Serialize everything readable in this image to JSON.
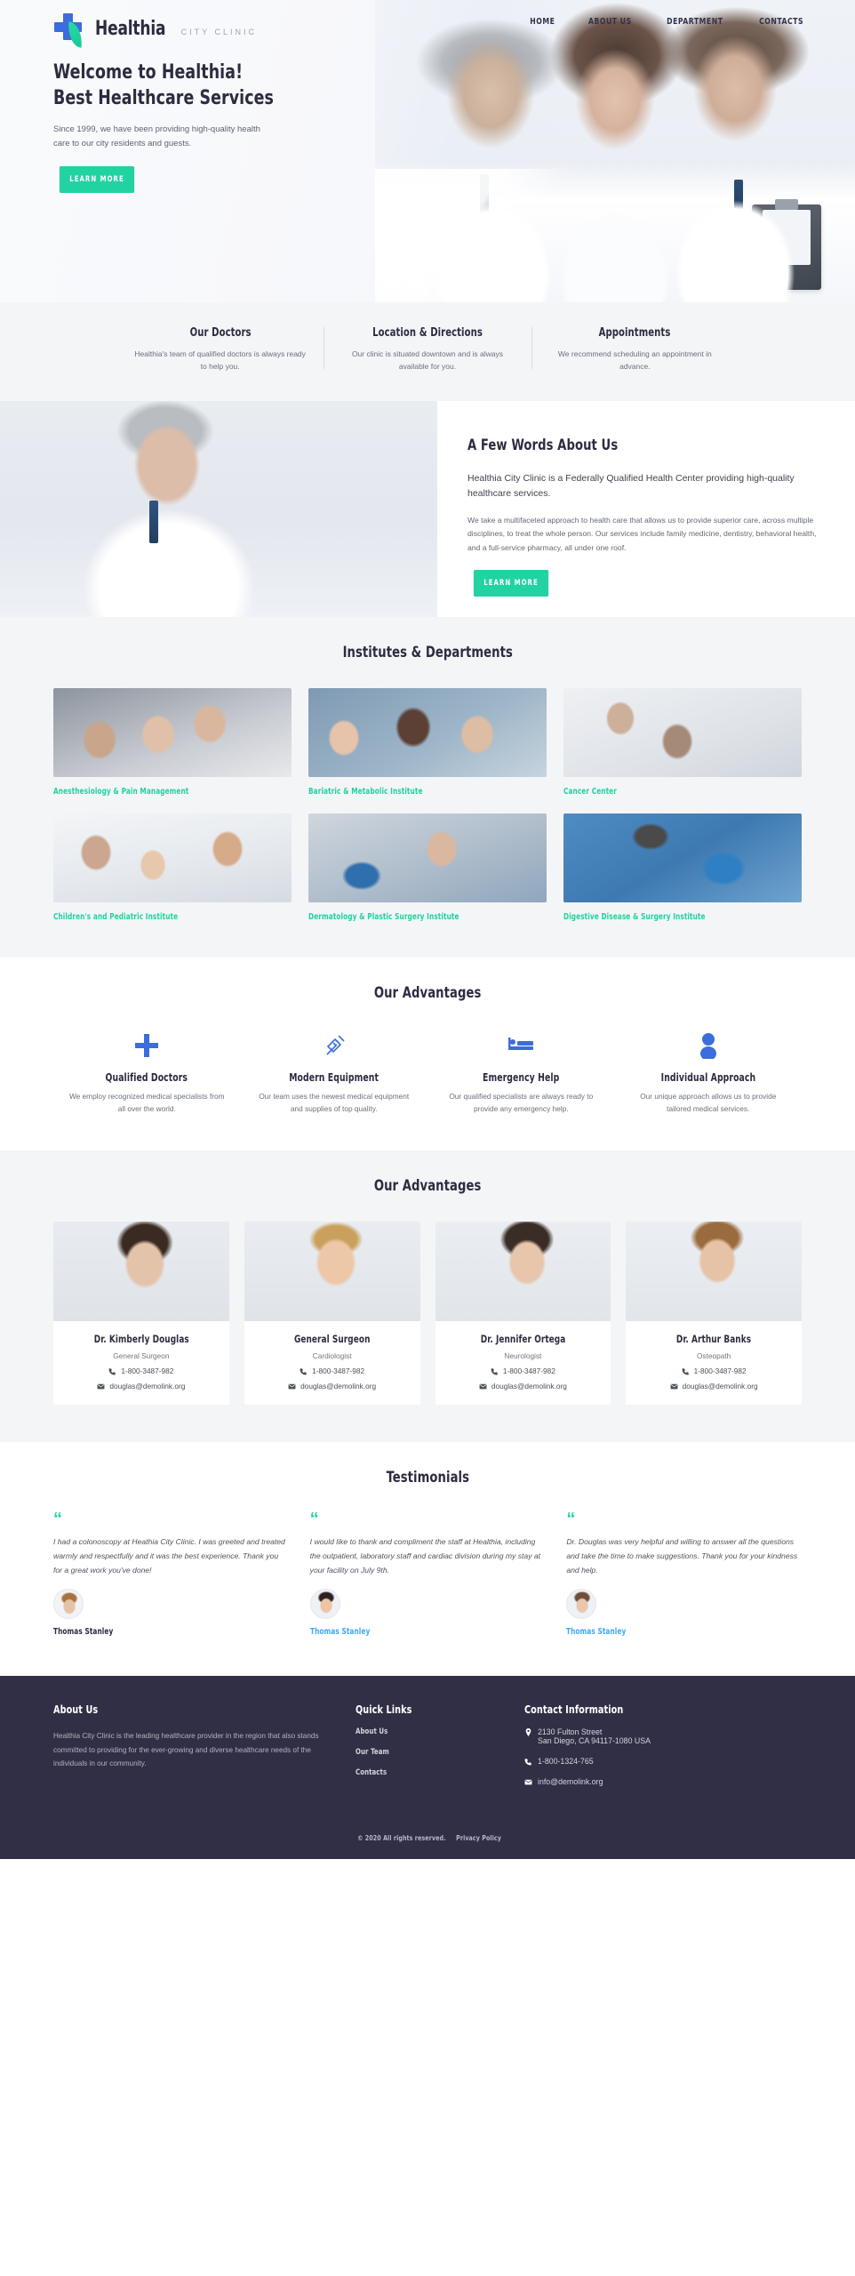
{
  "brand": {
    "name": "Healthia",
    "tagline": "CITY CLINIC"
  },
  "nav": {
    "items": [
      {
        "label": "HOME",
        "name": "nav-home"
      },
      {
        "label": "ABOUT US",
        "name": "nav-about-us"
      },
      {
        "label": "DEPARTMENT",
        "name": "nav-department"
      },
      {
        "label": "CONTACTS",
        "name": "nav-contacts"
      }
    ]
  },
  "hero": {
    "title_line1": "Welcome to Healthia!",
    "title_line2": "Best Healthcare Services",
    "paragraph": "Since 1999, we have been providing high-quality health care to our city residents and guests.",
    "cta": "LEARN MORE"
  },
  "strip": {
    "columns": [
      {
        "title": "Our Doctors",
        "text": "Healthia's team of qualified doctors is always ready to help you."
      },
      {
        "title": "Location & Directions",
        "text": "Our clinic is situated downtown and is always available for you."
      },
      {
        "title": "Appointments",
        "text": "We recommend scheduling an appointment in advance."
      }
    ]
  },
  "about": {
    "heading": "A Few Words About Us",
    "lead": "Healthia City Clinic is a Federally Qualified Health Center providing high-quality healthcare services.",
    "body": "We take a multifaceted approach to health care that allows us to provide superior care, across multiple disciplines, to treat the whole person. Our services include family medicine, dentistry, behavioral health, and a full-service pharmacy, all under one roof.",
    "cta": "LEARN MORE"
  },
  "departments": {
    "heading": "Institutes & Departments",
    "cards": [
      {
        "label": "Anesthesiology & Pain Management"
      },
      {
        "label": "Bariatric & Metabolic Institute"
      },
      {
        "label": "Cancer Center"
      },
      {
        "label": "Children's and Pediatric Institute"
      },
      {
        "label": "Dermatology & Plastic Surgery Institute"
      },
      {
        "label": "Digestive Disease & Surgery Institute"
      }
    ]
  },
  "advantages": {
    "heading": "Our Advantages",
    "items": [
      {
        "icon": "plus-icon",
        "title": "Qualified Doctors",
        "text": "We employ recognized medical specialists from all over the world."
      },
      {
        "icon": "syringe-icon",
        "title": "Modern Equipment",
        "text": "Our team uses the newest medical equipment and supplies of top quality."
      },
      {
        "icon": "hospital-bed-icon",
        "title": "Emergency Help",
        "text": "Our qualified specialists are always ready to provide any emergency help."
      },
      {
        "icon": "person-icon",
        "title": "Individual Approach",
        "text": "Our unique approach allows us to provide tailored medical services."
      }
    ]
  },
  "team": {
    "heading": "Our Advantages",
    "members": [
      {
        "name": "Dr. Kimberly Douglas",
        "role": "General Surgeon",
        "phone": "1-800-3487-982",
        "email": "douglas@demolink.org"
      },
      {
        "name": "General Surgeon",
        "role": "Cardiologist",
        "phone": "1-800-3487-982",
        "email": "douglas@demolink.org"
      },
      {
        "name": "Dr. Jennifer Ortega",
        "role": "Neurologist",
        "phone": "1-800-3487-982",
        "email": "douglas@demolink.org"
      },
      {
        "name": "Dr. Arthur Banks",
        "role": "Osteopath",
        "phone": "1-800-3487-982",
        "email": "douglas@demolink.org"
      }
    ]
  },
  "testimonials": {
    "heading": "Testimonials",
    "items": [
      {
        "quote": "I had a colonoscopy at Heathia City Clinic. I was greeted and treated warmly and respectfully and it was the best experience. Thank you for a great work you've done!",
        "author": "Thomas Stanley"
      },
      {
        "quote": "I would like to thank and compliment the staff at Healthia, including the outpatient, laboratory staff and cardiac division during my stay at your facility on July 9th.",
        "author": "Thomas Stanley"
      },
      {
        "quote": "Dr. Douglas was very helpful and willing to answer all the questions and take the time to make suggestions. Thank you for your kindness and help.",
        "author": "Thomas Stanley"
      }
    ]
  },
  "footer": {
    "about_heading": "About Us",
    "about_text": "Healthia City Clinic is the leading healthcare provider in the region that also stands committed to providing for the ever-growing and diverse healthcare needs of the individuals in our community.",
    "links_heading": "Quick Links",
    "links": [
      {
        "label": "About Us"
      },
      {
        "label": "Our Team"
      },
      {
        "label": "Contacts"
      }
    ],
    "contact_heading": "Contact Information",
    "address_line1": "2130 Fulton Street",
    "address_line2": "San Diego, CA 94117-1080 USA",
    "phone": "1-800-1324-765",
    "email": "info@demolink.org",
    "copyright": "© 2020 All rights reserved. ",
    "privacy": "Privacy Policy"
  },
  "colors": {
    "accent_green": "#22d3a2",
    "accent_blue": "#3b6ddd",
    "dark": "#2d2b40",
    "footer_bg": "#312f45",
    "link_blue": "#3fa9f5"
  }
}
